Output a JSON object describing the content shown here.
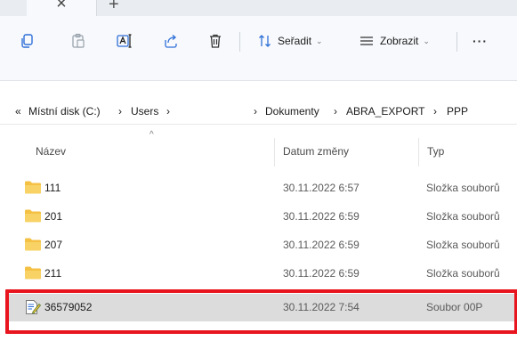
{
  "tabs": {
    "close_glyph": "×",
    "new_glyph": "+"
  },
  "toolbar": {
    "sort_label": "Seřadit",
    "view_label": "Zobrazit",
    "more_label": "···",
    "dropdown_glyph": "⌄"
  },
  "address": {
    "overflow_glyph": "«",
    "segments": [
      "Místní disk (C:)",
      "Users",
      "Dokumenty",
      "ABRA_EXPORT",
      "PPP"
    ],
    "separator": "›"
  },
  "columns": {
    "name": "Název",
    "date": "Datum změny",
    "type": "Typ"
  },
  "files": [
    {
      "name": "111",
      "date": "30.11.2022 6:57",
      "type": "Složka souborů",
      "kind": "folder"
    },
    {
      "name": "201",
      "date": "30.11.2022 6:59",
      "type": "Složka souborů",
      "kind": "folder"
    },
    {
      "name": "207",
      "date": "30.11.2022 6:59",
      "type": "Složka souborů",
      "kind": "folder"
    },
    {
      "name": "211",
      "date": "30.11.2022 6:59",
      "type": "Složka souborů",
      "kind": "folder"
    },
    {
      "name": "36579052",
      "date": "30.11.2022 7:54",
      "type": "Soubor 00P",
      "kind": "file",
      "selected": true
    }
  ],
  "colors": {
    "folder": "#f4c145",
    "selection": "#dcdcdc",
    "highlight": "#e8141e",
    "accent": "#2f6fd8"
  }
}
